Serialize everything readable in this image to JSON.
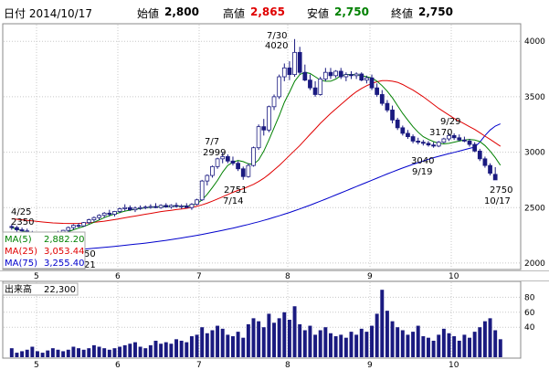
{
  "header": {
    "date_label": "日付 2014/10/17",
    "open_label": "始値",
    "open_value": "2,800",
    "high_label": "高値",
    "high_value": "2,865",
    "low_label": "安値",
    "low_value": "2,750",
    "close_label": "終値",
    "close_value": "2,750",
    "colors": {
      "high": "#e00000",
      "low": "#008000",
      "base": "#000000"
    }
  },
  "legend": {
    "ma5": "MA(5)",
    "ma5_value": "2,882.20",
    "ma25": "MA(25)",
    "ma25_value": "3,053.44",
    "ma75": "MA(75)",
    "ma75_value": "3,255.40"
  },
  "volume_label": "出来高",
  "volume_value": "22,300",
  "annotations": {
    "a1_date": "4/25",
    "a1_val": "2350",
    "a2_date": "7/7",
    "a2_val": "2999",
    "a3_val": "2751",
    "a3_date": "7/14",
    "a4_date": "7/30",
    "a4_val": "4020",
    "a5_date": "9/29",
    "a5_val": "3170",
    "a6_val": "3040",
    "a6_date": "9/19",
    "a7_val": "2750",
    "a7_date": "10/17",
    "cut1": "50",
    "cut2": "21"
  },
  "chart_data": {
    "type": "candlestick",
    "price_ylim": [
      1950,
      4150
    ],
    "price_ticks": [
      "4000",
      "3500",
      "3000",
      "2500",
      "2000"
    ],
    "volume_ticks": [
      "80",
      "60",
      "40"
    ],
    "volume_ylim": [
      0,
      100
    ],
    "x_ticks": [
      "5",
      "6",
      "7",
      "8",
      "9",
      "10"
    ],
    "colors": {
      "up": "#ffffff",
      "down": "#1a1a80",
      "ma5": "#008000",
      "ma25": "#e00000",
      "ma75": "#0000cc",
      "volume": "#1a1a80"
    },
    "candles": [
      [
        2330,
        2350,
        2300,
        2320
      ],
      [
        2320,
        2335,
        2280,
        2300
      ],
      [
        2300,
        2320,
        2270,
        2290
      ],
      [
        2290,
        2310,
        2260,
        2280
      ],
      [
        2280,
        2290,
        2220,
        2230
      ],
      [
        2230,
        2260,
        2210,
        2250
      ],
      [
        2250,
        2270,
        2220,
        2235
      ],
      [
        2235,
        2260,
        2220,
        2255
      ],
      [
        2255,
        2280,
        2240,
        2270
      ],
      [
        2270,
        2290,
        2250,
        2275
      ],
      [
        2275,
        2300,
        2260,
        2295
      ],
      [
        2295,
        2330,
        2280,
        2320
      ],
      [
        2320,
        2350,
        2300,
        2340
      ],
      [
        2340,
        2360,
        2320,
        2335
      ],
      [
        2335,
        2370,
        2330,
        2365
      ],
      [
        2365,
        2400,
        2350,
        2390
      ],
      [
        2390,
        2420,
        2370,
        2410
      ],
      [
        2410,
        2440,
        2390,
        2430
      ],
      [
        2430,
        2460,
        2410,
        2450
      ],
      [
        2450,
        2480,
        2420,
        2440
      ],
      [
        2440,
        2470,
        2420,
        2465
      ],
      [
        2465,
        2500,
        2450,
        2490
      ],
      [
        2490,
        2530,
        2470,
        2500
      ],
      [
        2500,
        2520,
        2470,
        2480
      ],
      [
        2480,
        2510,
        2460,
        2495
      ],
      [
        2495,
        2520,
        2480,
        2500
      ],
      [
        2500,
        2520,
        2485,
        2505
      ],
      [
        2505,
        2530,
        2490,
        2510
      ],
      [
        2510,
        2540,
        2495,
        2500
      ],
      [
        2500,
        2530,
        2490,
        2520
      ],
      [
        2520,
        2540,
        2500,
        2505
      ],
      [
        2505,
        2530,
        2490,
        2520
      ],
      [
        2520,
        2545,
        2500,
        2510
      ],
      [
        2510,
        2530,
        2490,
        2515
      ],
      [
        2515,
        2540,
        2500,
        2500
      ],
      [
        2500,
        2540,
        2480,
        2530
      ],
      [
        2530,
        2580,
        2520,
        2570
      ],
      [
        2570,
        2750,
        2560,
        2740
      ],
      [
        2740,
        2800,
        2700,
        2790
      ],
      [
        2790,
        2880,
        2770,
        2870
      ],
      [
        2870,
        2950,
        2850,
        2940
      ],
      [
        2940,
        2999,
        2900,
        2960
      ],
      [
        2960,
        2980,
        2900,
        2920
      ],
      [
        2920,
        2960,
        2880,
        2900
      ],
      [
        2900,
        2920,
        2830,
        2850
      ],
      [
        2850,
        2870,
        2751,
        2780
      ],
      [
        2780,
        2900,
        2770,
        2880
      ],
      [
        2880,
        3050,
        2870,
        3040
      ],
      [
        3040,
        3250,
        3020,
        3230
      ],
      [
        3230,
        3300,
        3150,
        3200
      ],
      [
        3200,
        3420,
        3180,
        3410
      ],
      [
        3410,
        3520,
        3380,
        3500
      ],
      [
        3500,
        3700,
        3480,
        3680
      ],
      [
        3680,
        3800,
        3640,
        3760
      ],
      [
        3760,
        3820,
        3650,
        3700
      ],
      [
        3700,
        4020,
        3680,
        3900
      ],
      [
        3900,
        3950,
        3700,
        3720
      ],
      [
        3720,
        3790,
        3640,
        3650
      ],
      [
        3650,
        3700,
        3560,
        3580
      ],
      [
        3580,
        3640,
        3500,
        3520
      ],
      [
        3520,
        3680,
        3510,
        3660
      ],
      [
        3660,
        3760,
        3640,
        3720
      ],
      [
        3720,
        3760,
        3660,
        3690
      ],
      [
        3690,
        3740,
        3670,
        3730
      ],
      [
        3730,
        3760,
        3660,
        3680
      ],
      [
        3680,
        3720,
        3640,
        3700
      ],
      [
        3700,
        3730,
        3660,
        3690
      ],
      [
        3690,
        3720,
        3660,
        3705
      ],
      [
        3705,
        3720,
        3640,
        3650
      ],
      [
        3650,
        3690,
        3620,
        3670
      ],
      [
        3670,
        3700,
        3560,
        3580
      ],
      [
        3580,
        3620,
        3500,
        3520
      ],
      [
        3520,
        3560,
        3420,
        3440
      ],
      [
        3440,
        3470,
        3360,
        3380
      ],
      [
        3380,
        3420,
        3260,
        3290
      ],
      [
        3290,
        3310,
        3200,
        3220
      ],
      [
        3220,
        3240,
        3150,
        3170
      ],
      [
        3170,
        3200,
        3120,
        3140
      ],
      [
        3140,
        3160,
        3080,
        3100
      ],
      [
        3100,
        3130,
        3070,
        3090
      ],
      [
        3090,
        3110,
        3060,
        3080
      ],
      [
        3080,
        3100,
        3050,
        3065
      ],
      [
        3065,
        3090,
        3040,
        3055
      ],
      [
        3055,
        3100,
        3045,
        3090
      ],
      [
        3090,
        3130,
        3080,
        3120
      ],
      [
        3120,
        3170,
        3100,
        3150
      ],
      [
        3150,
        3170,
        3110,
        3130
      ],
      [
        3130,
        3160,
        3100,
        3110
      ],
      [
        3110,
        3140,
        3090,
        3100
      ],
      [
        3100,
        3120,
        3050,
        3070
      ],
      [
        3070,
        3090,
        3000,
        3010
      ],
      [
        3010,
        3030,
        2920,
        2940
      ],
      [
        2940,
        2960,
        2860,
        2880
      ],
      [
        2880,
        2900,
        2790,
        2810
      ],
      [
        2800,
        2865,
        2750,
        2750
      ]
    ],
    "ma5": [
      2320,
      2305,
      2290,
      2278,
      2265,
      2255,
      2248,
      2246,
      2250,
      2258,
      2268,
      2283,
      2300,
      2315,
      2330,
      2348,
      2368,
      2388,
      2410,
      2428,
      2442,
      2456,
      2468,
      2477,
      2485,
      2492,
      2498,
      2502,
      2505,
      2508,
      2510,
      2512,
      2514,
      2514,
      2514,
      2520,
      2535,
      2570,
      2620,
      2680,
      2745,
      2820,
      2880,
      2910,
      2925,
      2915,
      2895,
      2890,
      2930,
      3010,
      3110,
      3220,
      3330,
      3450,
      3540,
      3640,
      3700,
      3720,
      3710,
      3680,
      3650,
      3640,
      3640,
      3660,
      3690,
      3700,
      3700,
      3700,
      3690,
      3680,
      3670,
      3640,
      3600,
      3550,
      3490,
      3420,
      3350,
      3290,
      3230,
      3180,
      3140,
      3115,
      3095,
      3080,
      3075,
      3080,
      3090,
      3100,
      3110,
      3115,
      3110,
      3095,
      3060,
      3010,
      2950,
      2882
    ],
    "ma25": [
      2400,
      2395,
      2390,
      2385,
      2380,
      2375,
      2370,
      2366,
      2362,
      2360,
      2358,
      2357,
      2357,
      2358,
      2360,
      2363,
      2367,
      2372,
      2378,
      2385,
      2392,
      2400,
      2408,
      2416,
      2424,
      2432,
      2440,
      2448,
      2456,
      2464,
      2470,
      2476,
      2482,
      2488,
      2494,
      2502,
      2512,
      2525,
      2540,
      2558,
      2578,
      2598,
      2618,
      2638,
      2655,
      2670,
      2690,
      2710,
      2735,
      2765,
      2800,
      2840,
      2880,
      2925,
      2970,
      3015,
      3060,
      3110,
      3160,
      3210,
      3260,
      3305,
      3350,
      3390,
      3430,
      3470,
      3510,
      3545,
      3575,
      3600,
      3620,
      3635,
      3645,
      3645,
      3640,
      3630,
      3610,
      3585,
      3560,
      3530,
      3500,
      3465,
      3430,
      3395,
      3365,
      3335,
      3305,
      3280,
      3255,
      3230,
      3205,
      3175,
      3145,
      3115,
      3085,
      3053
    ],
    "ma75": [
      2070,
      2074,
      2078,
      2082,
      2086,
      2090,
      2094,
      2098,
      2102,
      2106,
      2110,
      2114,
      2118,
      2122,
      2126,
      2130,
      2134,
      2138,
      2142,
      2146,
      2150,
      2155,
      2160,
      2165,
      2170,
      2175,
      2180,
      2186,
      2192,
      2198,
      2205,
      2212,
      2219,
      2226,
      2234,
      2242,
      2250,
      2258,
      2267,
      2276,
      2285,
      2295,
      2305,
      2315,
      2326,
      2337,
      2348,
      2360,
      2372,
      2385,
      2398,
      2412,
      2426,
      2441,
      2456,
      2472,
      2488,
      2505,
      2522,
      2540,
      2558,
      2576,
      2595,
      2614,
      2633,
      2652,
      2671,
      2690,
      2709,
      2728,
      2747,
      2766,
      2785,
      2804,
      2822,
      2840,
      2857,
      2874,
      2890,
      2906,
      2921,
      2936,
      2950,
      2963,
      2975,
      2987,
      2998,
      3010,
      3022,
      3034,
      3046,
      3090,
      3150,
      3200,
      3235,
      3255
    ],
    "volumes": [
      12,
      6,
      8,
      10,
      14,
      8,
      6,
      9,
      12,
      10,
      8,
      10,
      14,
      12,
      10,
      12,
      16,
      14,
      12,
      10,
      12,
      14,
      16,
      18,
      20,
      14,
      12,
      16,
      22,
      18,
      20,
      18,
      24,
      22,
      20,
      28,
      30,
      40,
      32,
      36,
      42,
      38,
      30,
      28,
      34,
      26,
      44,
      52,
      48,
      40,
      58,
      46,
      52,
      60,
      50,
      68,
      44,
      36,
      42,
      30,
      36,
      40,
      32,
      28,
      30,
      26,
      34,
      30,
      38,
      34,
      42,
      58,
      90,
      62,
      48,
      40,
      36,
      30,
      34,
      42,
      28,
      26,
      22,
      30,
      38,
      32,
      28,
      22,
      30,
      26,
      34,
      40,
      48,
      52,
      36,
      24
    ]
  }
}
